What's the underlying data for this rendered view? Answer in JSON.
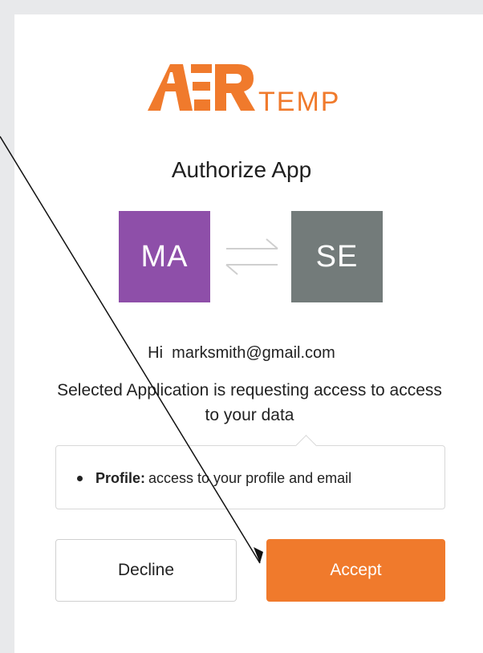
{
  "brand": {
    "wordmark": "TEMP",
    "color": "#f07a2c"
  },
  "title": "Authorize App",
  "apps": {
    "left": {
      "initials": "MA",
      "color": "#8e4fa9"
    },
    "right": {
      "initials": "SE",
      "color": "#737b7a"
    },
    "swap_icon": "swap-arrows-icon"
  },
  "greeting": "Hi  marksmith@gmail.com",
  "request_text": "Selected Application is requesting access to access to your data",
  "scopes": [
    {
      "name": "Profile:",
      "description": "access to your profile and email"
    }
  ],
  "buttons": {
    "decline": "Decline",
    "accept": "Accept",
    "accept_color": "#f07a2c"
  }
}
